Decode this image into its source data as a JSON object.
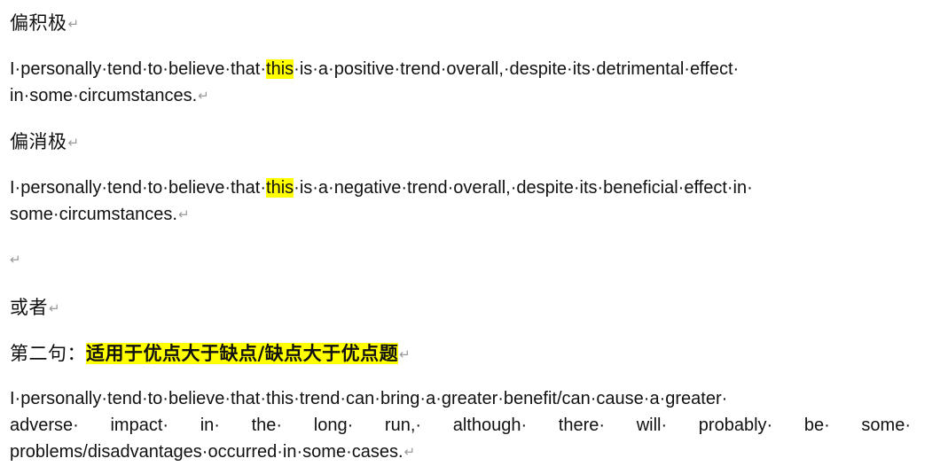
{
  "paragraph_mark": "↵",
  "sections": {
    "positive_heading": "偏积极",
    "positive_line1_a": "I·personally·tend·to·believe·that·",
    "positive_highlight": "this",
    "positive_line1_b": "·is·a·positive·trend·overall,·despite·its·detrimental·effect·",
    "positive_line2": "in·some·circumstances.",
    "negative_heading": "偏消极",
    "negative_line1_a": "I·personally·tend·to·believe·that·",
    "negative_highlight": "this",
    "negative_line1_b": "·is·a·negative·trend·overall,·despite·its·beneficial·effect·in·",
    "negative_line2": "some·circumstances.",
    "or_text": "或者",
    "second_label": "第二句：",
    "second_highlight": "适用于优点大于缺点/缺点大于优点题",
    "third_line1": "I·personally·tend·to·believe·that·this·trend·can·bring·a·greater·benefit/can·cause·a·greater·",
    "third_line2": "adverse· impact· in· the· long· run,· although· there· will· probably· be· some·",
    "third_line3": "problems/disadvantages·occurred·in·some·cases."
  }
}
